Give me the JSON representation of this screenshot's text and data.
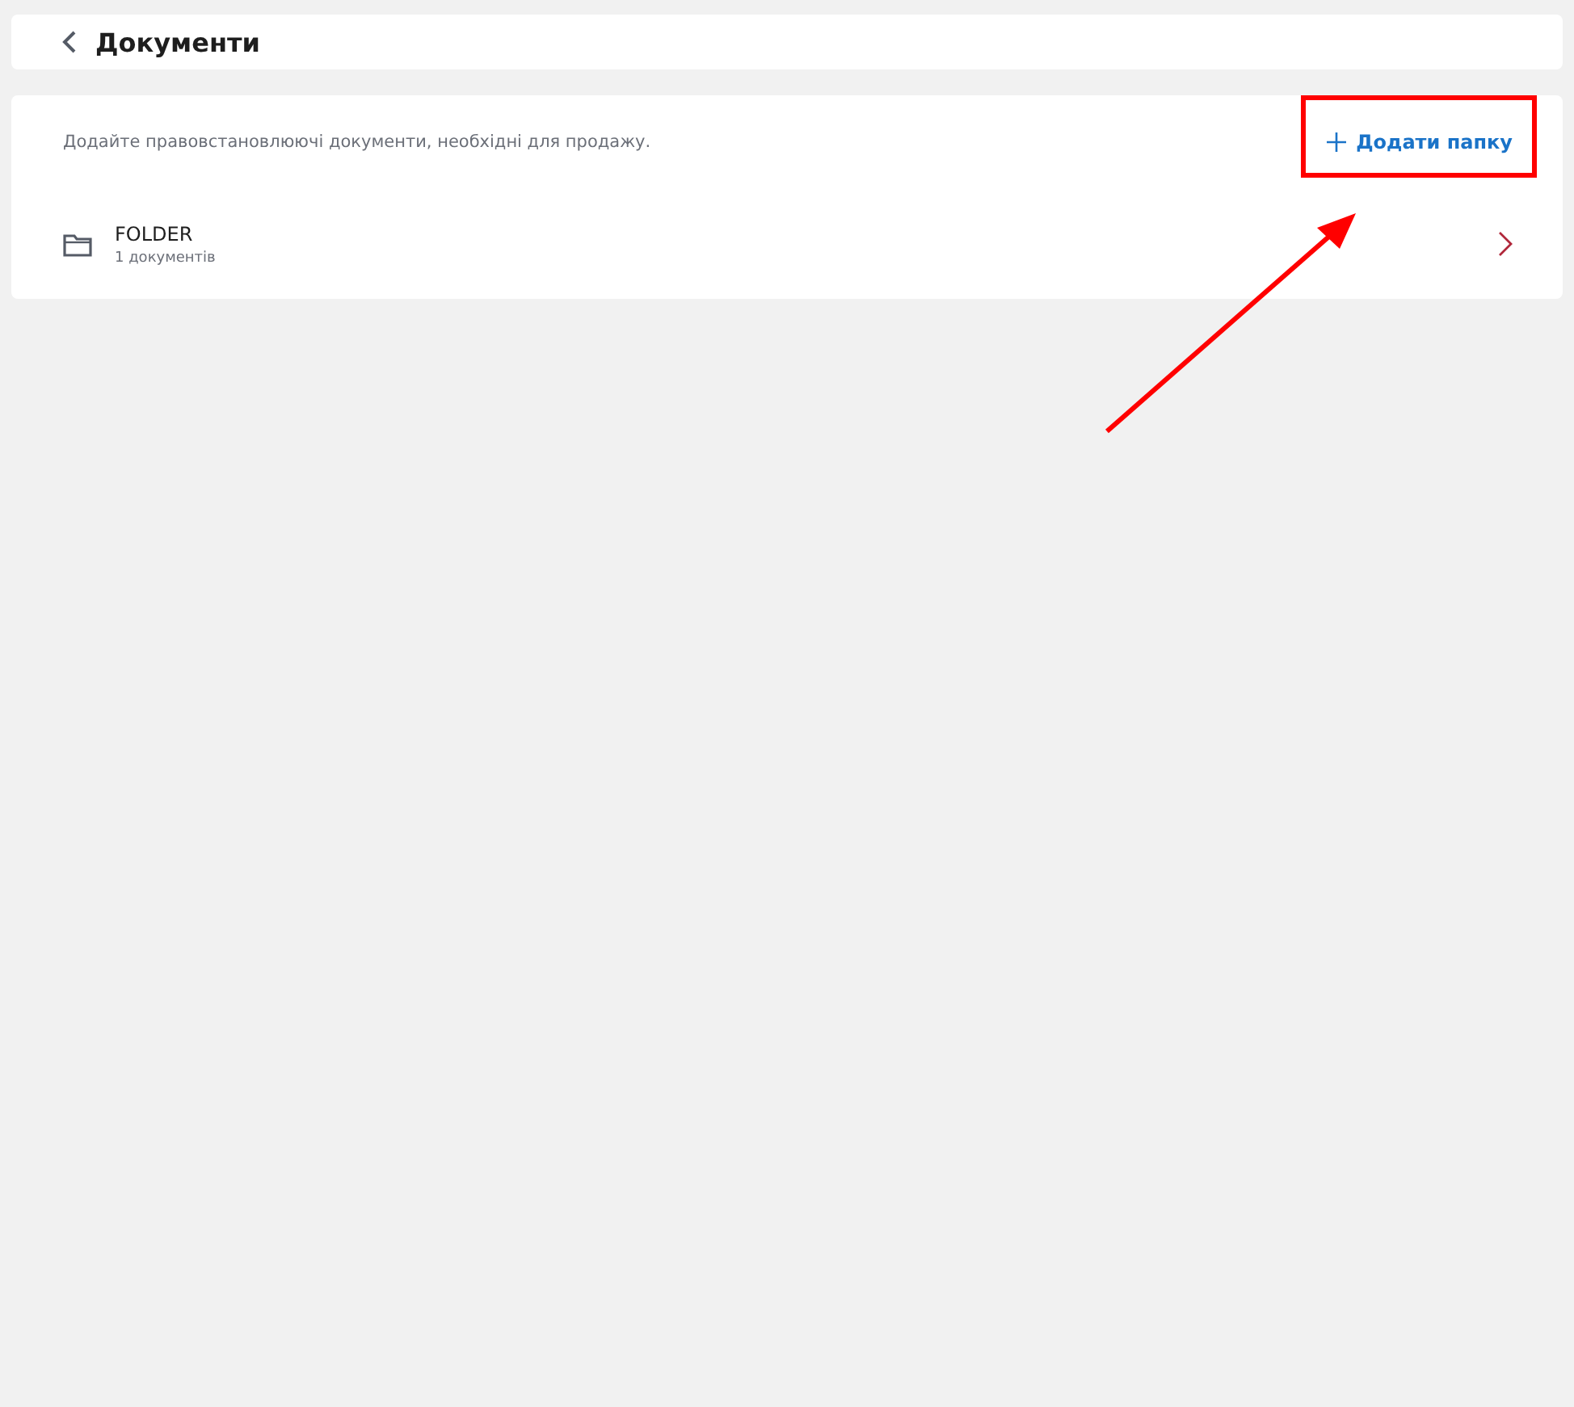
{
  "header": {
    "title": "Документи"
  },
  "panel": {
    "description": "Додайте правовстановлюючі документи, необхідні для продажу.",
    "add_button": "Додати папку",
    "folders": [
      {
        "name": "FOLDER",
        "count": "1 документів"
      }
    ]
  }
}
